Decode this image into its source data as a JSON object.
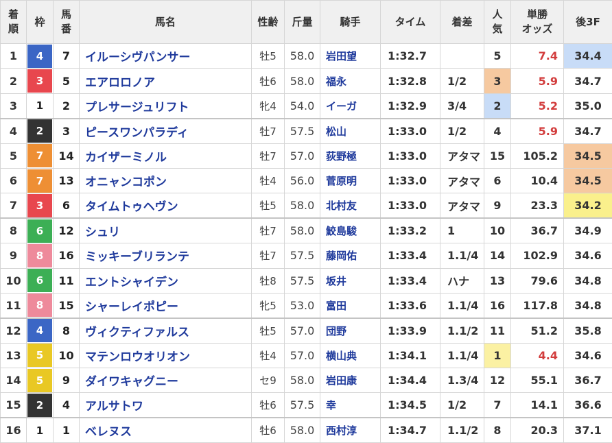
{
  "headers": {
    "rank": [
      "着",
      "順"
    ],
    "waku": "枠",
    "umaban": [
      "馬",
      "番"
    ],
    "horse": "馬名",
    "sex_age": "性齢",
    "weight": "斤量",
    "jockey": "騎手",
    "time": "タイム",
    "margin": "着差",
    "popularity": [
      "人",
      "気"
    ],
    "odds": [
      "単勝",
      "オッズ"
    ],
    "last3f": "後3F"
  },
  "colors": {
    "waku": {
      "1": {
        "bg": "#ffffff",
        "fg": "#222222"
      },
      "2": {
        "bg": "#333333",
        "fg": "#ffffff"
      },
      "3": {
        "bg": "#e8474e",
        "fg": "#ffffff"
      },
      "4": {
        "bg": "#3b66c5",
        "fg": "#ffffff"
      },
      "5": {
        "bg": "#e9c824",
        "fg": "#ffffff"
      },
      "6": {
        "bg": "#3caf55",
        "fg": "#ffffff"
      },
      "7": {
        "bg": "#ee8f34",
        "fg": "#ffffff"
      },
      "8": {
        "bg": "#ee8a9b",
        "fg": "#ffffff"
      }
    },
    "horse_link": "#1f3a9c",
    "favorite_odds": "#d23c3c",
    "highlight_orange": "#f6c9a0",
    "highlight_blue": "#c8dcf7",
    "highlight_yellow": "#faf08c"
  },
  "rows": [
    {
      "rank": "1",
      "waku": "4",
      "umaban": "7",
      "horse": "イルーシヴパンサー",
      "sex_age": "牡5",
      "weight": "58.0",
      "jockey": "岩田望",
      "time": "1:32.7",
      "margin": "",
      "popularity": "5",
      "odds": "7.4",
      "odds_fav": true,
      "last3f": "34.4",
      "pop_hl": "",
      "l3f_hl": "blue"
    },
    {
      "rank": "2",
      "waku": "3",
      "umaban": "5",
      "horse": "エアロロノア",
      "sex_age": "牡6",
      "weight": "58.0",
      "jockey": "福永",
      "time": "1:32.8",
      "margin": "1/2",
      "popularity": "3",
      "odds": "5.9",
      "odds_fav": true,
      "last3f": "34.7",
      "pop_hl": "orange",
      "l3f_hl": ""
    },
    {
      "rank": "3",
      "waku": "1",
      "umaban": "2",
      "horse": "プレサージュリフト",
      "sex_age": "牝4",
      "weight": "54.0",
      "jockey": "イーガ",
      "time": "1:32.9",
      "margin": "3/4",
      "popularity": "2",
      "odds": "5.2",
      "odds_fav": true,
      "last3f": "35.0",
      "pop_hl": "blue",
      "l3f_hl": ""
    },
    {
      "rank": "4",
      "waku": "2",
      "umaban": "3",
      "horse": "ピースワンパラディ",
      "sex_age": "牡7",
      "weight": "57.5",
      "jockey": "松山",
      "time": "1:33.0",
      "margin": "1/2",
      "popularity": "4",
      "odds": "5.9",
      "odds_fav": true,
      "last3f": "34.7",
      "pop_hl": "",
      "l3f_hl": ""
    },
    {
      "rank": "5",
      "waku": "7",
      "umaban": "14",
      "horse": "カイザーミノル",
      "sex_age": "牡7",
      "weight": "57.0",
      "jockey": "荻野極",
      "time": "1:33.0",
      "margin": "アタマ",
      "popularity": "15",
      "odds": "105.2",
      "odds_fav": false,
      "last3f": "34.5",
      "pop_hl": "",
      "l3f_hl": "orange"
    },
    {
      "rank": "6",
      "waku": "7",
      "umaban": "13",
      "horse": "オニャンコポン",
      "sex_age": "牡4",
      "weight": "56.0",
      "jockey": "菅原明",
      "time": "1:33.0",
      "margin": "アタマ",
      "popularity": "6",
      "odds": "10.4",
      "odds_fav": false,
      "last3f": "34.5",
      "pop_hl": "",
      "l3f_hl": "orange"
    },
    {
      "rank": "7",
      "waku": "3",
      "umaban": "6",
      "horse": "タイムトゥヘヴン",
      "sex_age": "牡5",
      "weight": "58.0",
      "jockey": "北村友",
      "time": "1:33.0",
      "margin": "アタマ",
      "popularity": "9",
      "odds": "23.3",
      "odds_fav": false,
      "last3f": "34.2",
      "pop_hl": "",
      "l3f_hl": "yellow"
    },
    {
      "rank": "8",
      "waku": "6",
      "umaban": "12",
      "horse": "シュリ",
      "sex_age": "牡7",
      "weight": "58.0",
      "jockey": "鮫島駿",
      "time": "1:33.2",
      "margin": "1",
      "popularity": "10",
      "odds": "36.7",
      "odds_fav": false,
      "last3f": "34.9",
      "pop_hl": "",
      "l3f_hl": ""
    },
    {
      "rank": "9",
      "waku": "8",
      "umaban": "16",
      "horse": "ミッキーブリランテ",
      "sex_age": "牡7",
      "weight": "57.5",
      "jockey": "藤岡佑",
      "time": "1:33.4",
      "margin": "1.1/4",
      "popularity": "14",
      "odds": "102.9",
      "odds_fav": false,
      "last3f": "34.6",
      "pop_hl": "",
      "l3f_hl": ""
    },
    {
      "rank": "10",
      "waku": "6",
      "umaban": "11",
      "horse": "エントシャイデン",
      "sex_age": "牡8",
      "weight": "57.5",
      "jockey": "坂井",
      "time": "1:33.4",
      "margin": "ハナ",
      "popularity": "13",
      "odds": "79.6",
      "odds_fav": false,
      "last3f": "34.8",
      "pop_hl": "",
      "l3f_hl": ""
    },
    {
      "rank": "11",
      "waku": "8",
      "umaban": "15",
      "horse": "シャーレイポピー",
      "sex_age": "牝5",
      "weight": "53.0",
      "jockey": "富田",
      "time": "1:33.6",
      "margin": "1.1/4",
      "popularity": "16",
      "odds": "117.8",
      "odds_fav": false,
      "last3f": "34.8",
      "pop_hl": "",
      "l3f_hl": ""
    },
    {
      "rank": "12",
      "waku": "4",
      "umaban": "8",
      "horse": "ヴィクティファルス",
      "sex_age": "牡5",
      "weight": "57.0",
      "jockey": "団野",
      "time": "1:33.9",
      "margin": "1.1/2",
      "popularity": "11",
      "odds": "51.2",
      "odds_fav": false,
      "last3f": "35.8",
      "pop_hl": "",
      "l3f_hl": ""
    },
    {
      "rank": "13",
      "waku": "5",
      "umaban": "10",
      "horse": "マテンロウオリオン",
      "sex_age": "牡4",
      "weight": "57.0",
      "jockey": "横山典",
      "time": "1:34.1",
      "margin": "1.1/4",
      "popularity": "1",
      "odds": "4.4",
      "odds_fav": true,
      "last3f": "34.6",
      "pop_hl": "yellow",
      "l3f_hl": ""
    },
    {
      "rank": "14",
      "waku": "5",
      "umaban": "9",
      "horse": "ダイワキャグニー",
      "sex_age": "セ9",
      "weight": "58.0",
      "jockey": "岩田康",
      "time": "1:34.4",
      "margin": "1.3/4",
      "popularity": "12",
      "odds": "55.1",
      "odds_fav": false,
      "last3f": "36.7",
      "pop_hl": "",
      "l3f_hl": ""
    },
    {
      "rank": "15",
      "waku": "2",
      "umaban": "4",
      "horse": "アルサトワ",
      "sex_age": "牡6",
      "weight": "57.5",
      "jockey": "幸",
      "time": "1:34.5",
      "margin": "1/2",
      "popularity": "7",
      "odds": "14.1",
      "odds_fav": false,
      "last3f": "36.6",
      "pop_hl": "",
      "l3f_hl": ""
    },
    {
      "rank": "16",
      "waku": "1",
      "umaban": "1",
      "horse": "ベレヌス",
      "sex_age": "牡6",
      "weight": "58.0",
      "jockey": "西村淳",
      "time": "1:34.7",
      "margin": "1.1/2",
      "popularity": "8",
      "odds": "20.3",
      "odds_fav": false,
      "last3f": "37.1",
      "pop_hl": "",
      "l3f_hl": ""
    }
  ]
}
